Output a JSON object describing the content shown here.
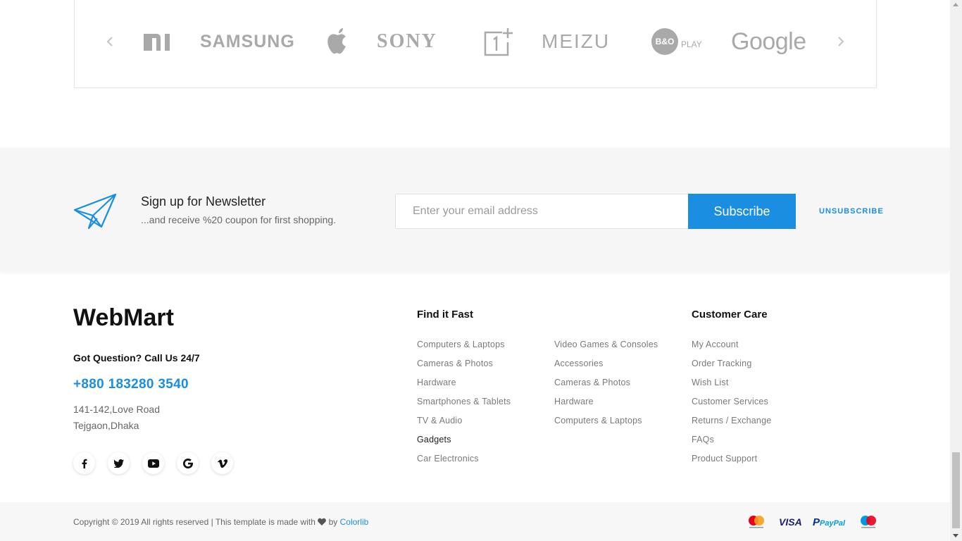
{
  "brands": {
    "items": [
      {
        "name": "mi",
        "label": "mi"
      },
      {
        "name": "samsung",
        "label": "SAMSUNG"
      },
      {
        "name": "apple",
        "label": ""
      },
      {
        "name": "sony",
        "label": "SONY"
      },
      {
        "name": "oneplus",
        "label": "1"
      },
      {
        "name": "meizu",
        "label": "MEIZU"
      },
      {
        "name": "bo-play",
        "label": "PLAY",
        "badge": "B&O"
      },
      {
        "name": "google",
        "label": "Google"
      }
    ],
    "logo_color": "#a9a9a9"
  },
  "newsletter": {
    "title": "Sign up for Newsletter",
    "subtitle": "...and receive %20 coupon for first shopping.",
    "placeholder": "Enter your email address",
    "button": "Subscribe",
    "unsubscribe": "UNSUBSCRIBE",
    "accent": "#1a8ee1"
  },
  "footer": {
    "brand": "WebMart",
    "question": "Got Question? Call Us 24/7",
    "phone": "+880 183280 3540",
    "address_line1": "141-142,Love Road",
    "address_line2": "Tejgaon,Dhaka",
    "socials": [
      "facebook-icon",
      "twitter-icon",
      "youtube-icon",
      "google-icon",
      "vimeo-icon"
    ],
    "find_it_fast": {
      "title": "Find it Fast",
      "col1": [
        "Computers & Laptops",
        "Cameras & Photos",
        "Hardware",
        "Smartphones & Tablets",
        "TV & Audio",
        "Gadgets",
        "Car Electronics"
      ],
      "col2": [
        "Video Games & Consoles",
        "Accessories",
        "Cameras & Photos",
        "Hardware",
        "Computers & Laptops"
      ]
    },
    "customer_care": {
      "title": "Customer Care",
      "links": [
        "My Account",
        "Order Tracking",
        "Wish List",
        "Customer Services",
        "Returns / Exchange",
        "FAQs",
        "Product Support"
      ]
    }
  },
  "bottom": {
    "copyright_prefix": "Copyright © 2019 All rights reserved | This template is made with",
    "by": "by",
    "credit": "Colorlib",
    "payments": [
      "mastercard-icon",
      "visa-icon",
      "paypal-icon",
      "maestro-icon"
    ],
    "visa_label": "VISA",
    "paypal_label": "PayPal"
  }
}
